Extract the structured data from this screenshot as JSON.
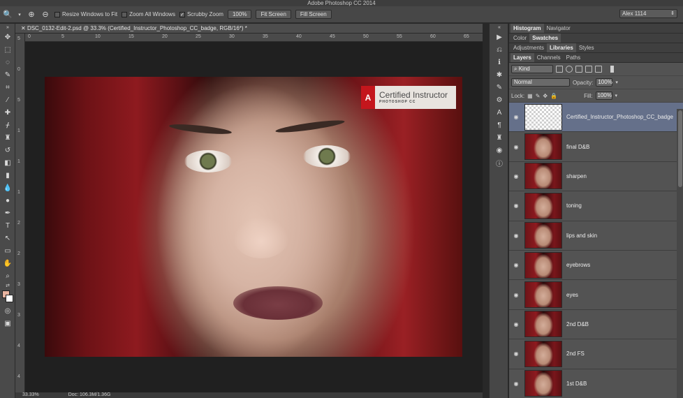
{
  "app": {
    "title": "Adobe Photoshop CC 2014",
    "workspace": "Alex 1114"
  },
  "options": {
    "resize_windows": "Resize Windows to Fit",
    "zoom_all": "Zoom All Windows",
    "scrubby": "Scrubby Zoom",
    "zoom_value": "100%",
    "fit_screen": "Fit Screen",
    "fill_screen": "Fill Screen"
  },
  "document": {
    "tab_title": "DSC_0132-Edit-2.psd @ 33.3% (Certified_Instructor_Photoshop_CC_badge, RGB/16*) *",
    "zoom": "33.33%",
    "doc_info": "Doc: 106.3M/1.36G",
    "ruler_top": [
      "0",
      "5",
      "10",
      "15",
      "20",
      "25",
      "30",
      "35",
      "40",
      "45",
      "50",
      "55",
      "60",
      "65"
    ],
    "ruler_left": [
      "5",
      "0",
      "5",
      "1",
      "1",
      "1",
      "2",
      "2",
      "3",
      "3",
      "4",
      "4"
    ]
  },
  "badge": {
    "logo": "A",
    "title": "Certified Instructor",
    "subtitle": "PHOTOSHOP CC",
    "logo_text": "Adobe"
  },
  "panels": {
    "row1": [
      "Histogram",
      "Navigator"
    ],
    "row2": [
      "Color",
      "Swatches"
    ],
    "row3": [
      "Adjustments",
      "Libraries",
      "Styles"
    ],
    "row4": [
      "Layers",
      "Channels",
      "Paths"
    ],
    "kind": "Kind",
    "blend_mode": "Normal",
    "opacity_label": "Opacity:",
    "opacity_value": "100%",
    "lock_label": "Lock:",
    "fill_label": "Fill:",
    "fill_value": "100%"
  },
  "layers": [
    {
      "name": "Certified_Instructor_Photoshop_CC_badge",
      "selected": true
    },
    {
      "name": "final D&B"
    },
    {
      "name": "sharpen"
    },
    {
      "name": "toning"
    },
    {
      "name": "lips and skin"
    },
    {
      "name": "eyebrows"
    },
    {
      "name": "eyes"
    },
    {
      "name": "2nd D&B"
    },
    {
      "name": "2nd FS"
    },
    {
      "name": "1st D&B"
    }
  ],
  "colors": {
    "foreground": "#e8b4a0",
    "background": "#ffffff",
    "selected_layer": "#65708a",
    "adobe_red": "#c4161c"
  }
}
